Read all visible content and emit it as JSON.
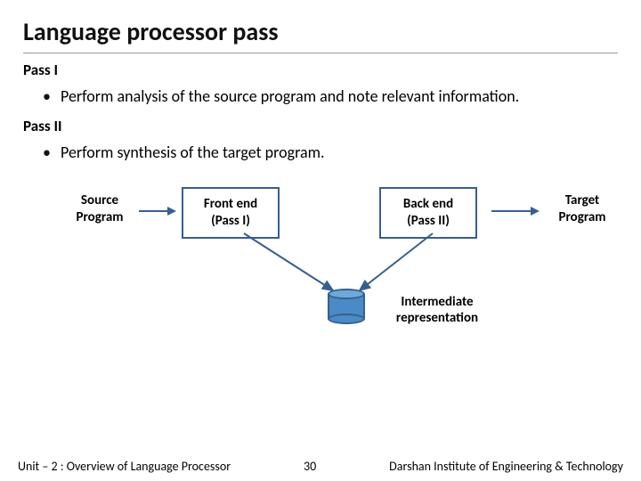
{
  "title": "Language processor pass",
  "sections": {
    "pass1": {
      "heading": "Pass I",
      "bullet": "Perform analysis of the source program and note relevant information."
    },
    "pass2": {
      "heading": "Pass II",
      "bullet": "Perform synthesis of the target program."
    }
  },
  "diagram": {
    "source": {
      "l1": "Source",
      "l2": "Program"
    },
    "front": {
      "l1": "Front end",
      "l2": "(Pass I)"
    },
    "back": {
      "l1": "Back end",
      "l2": "(Pass II)"
    },
    "target": {
      "l1": "Target",
      "l2": "Program"
    },
    "ir": {
      "l1": "Intermediate",
      "l2": "representation"
    }
  },
  "footer": {
    "left": "Unit – 2  : Overview of Language Processor",
    "page": "30",
    "right": "Darshan Institute of Engineering & Technology"
  },
  "colors": {
    "boxBorder": "#365f8f",
    "cylinderFill": "#4a8ac6"
  }
}
